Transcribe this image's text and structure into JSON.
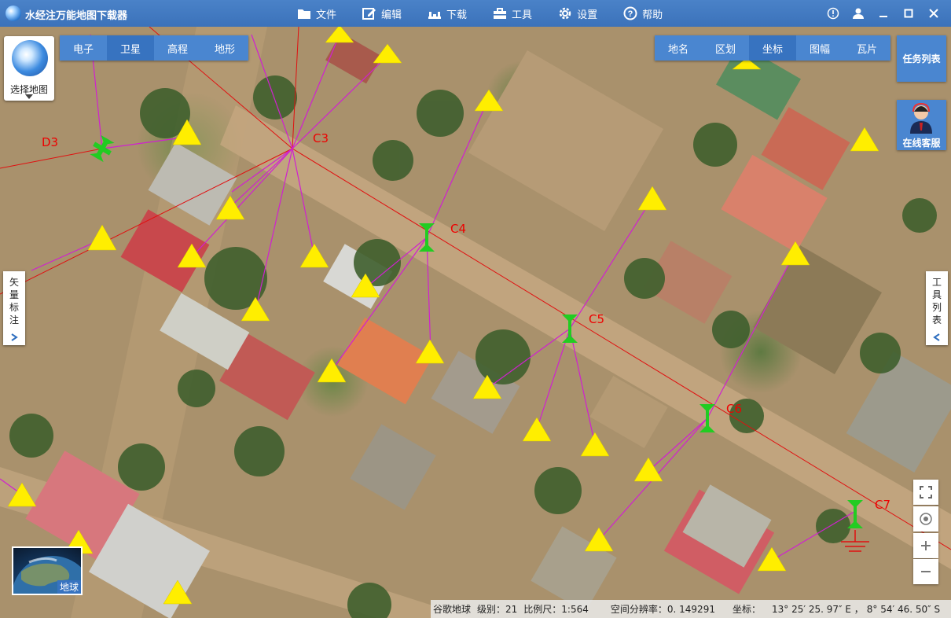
{
  "app": {
    "title": "水经注万能地图下载器"
  },
  "menu": [
    {
      "label": "文件",
      "icon": "folder-icon"
    },
    {
      "label": "编辑",
      "icon": "edit-icon"
    },
    {
      "label": "下载",
      "icon": "download-icon"
    },
    {
      "label": "工具",
      "icon": "toolbox-icon"
    },
    {
      "label": "设置",
      "icon": "gear-icon"
    },
    {
      "label": "帮助",
      "icon": "help-icon"
    }
  ],
  "map_types": {
    "items": [
      "电子",
      "卫星",
      "高程",
      "地形"
    ],
    "active": "卫星"
  },
  "overlay_tabs": {
    "items": [
      "地名",
      "区划",
      "坐标",
      "图幅",
      "瓦片"
    ],
    "active": "坐标"
  },
  "map_chooser": {
    "label": "选择地图"
  },
  "vector_annotation": {
    "label": "矢量标注"
  },
  "tool_list": {
    "label": "工具列表"
  },
  "task_list": {
    "label": "任务列表"
  },
  "online_service": {
    "label": "在线客服"
  },
  "earth_button": {
    "label": "地球"
  },
  "points": [
    {
      "label": "D3"
    },
    {
      "label": "C3"
    },
    {
      "label": "C4"
    },
    {
      "label": "C5"
    },
    {
      "label": "C6"
    },
    {
      "label": "C7"
    }
  ],
  "status": {
    "source": "谷歌地球",
    "level": "级别：21",
    "scale": "比例尺：1:564",
    "resolution": "空间分辨率：0. 149291",
    "coord_label": "坐标：",
    "longitude": "13° 25′ 25. 97″ E ，",
    "latitude": "8° 54′ 46. 50″ S"
  },
  "colors": {
    "title_bar": "#3b72ba",
    "panel": "#4a86d0",
    "active_tab": "#3773c0",
    "route_line": "#e01010",
    "connector_line": "#d020d0",
    "marker": "#ffee00",
    "station": "#22cc22"
  }
}
